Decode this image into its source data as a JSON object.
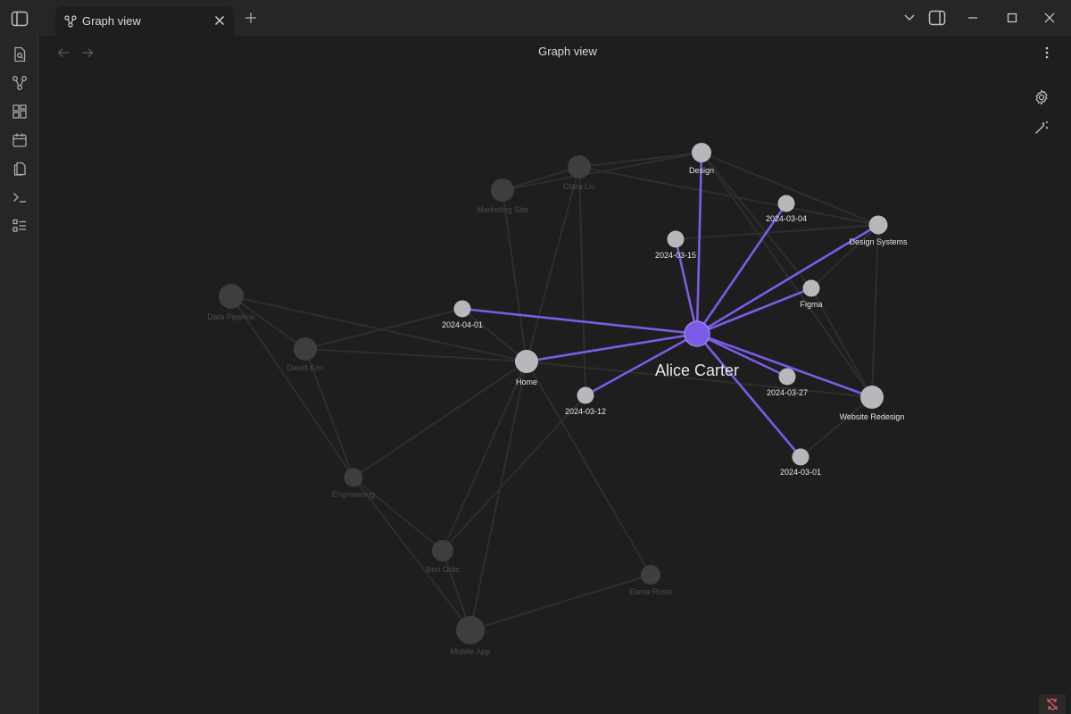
{
  "tab": {
    "label": "Graph view",
    "icon": "graph-icon"
  },
  "header": {
    "title": "Graph view"
  },
  "colors": {
    "background": "#1e1e1e",
    "accent": "#7c5ce6",
    "node_active": "#b8b8bc",
    "node_dim": "#3e3e3e",
    "edge_dim": "#2e2e2e"
  },
  "icons": {
    "ribbon": [
      "open-quick-switcher-icon",
      "graph-icon",
      "canvas-icon",
      "calendar-icon",
      "files-icon",
      "terminal-icon",
      "tasks-icon"
    ],
    "graph_controls": [
      "gear-icon",
      "magic-wand-icon"
    ]
  },
  "graph": {
    "focus": "Alice Carter",
    "nodes": [
      {
        "id": "alice",
        "label": "Alice Carter",
        "state": "focus"
      },
      {
        "id": "design",
        "label": "Design",
        "state": "linked"
      },
      {
        "id": "d0304",
        "label": "2024-03-04",
        "state": "linked"
      },
      {
        "id": "designsys",
        "label": "Design Systems",
        "state": "linked"
      },
      {
        "id": "d0315",
        "label": "2024-03-15",
        "state": "linked"
      },
      {
        "id": "figma",
        "label": "Figma",
        "state": "linked"
      },
      {
        "id": "d0401",
        "label": "2024-04-01",
        "state": "linked"
      },
      {
        "id": "home",
        "label": "Home",
        "state": "linked"
      },
      {
        "id": "d0312",
        "label": "2024-03-12",
        "state": "linked"
      },
      {
        "id": "d0327",
        "label": "2024-03-27",
        "state": "linked"
      },
      {
        "id": "website",
        "label": "Website Redesign",
        "state": "linked"
      },
      {
        "id": "d0301",
        "label": "2024-03-01",
        "state": "linked"
      },
      {
        "id": "clara",
        "label": "Clara Lin",
        "state": "dim"
      },
      {
        "id": "marketing",
        "label": "Marketing Site",
        "state": "dim"
      },
      {
        "id": "datapipe",
        "label": "Data Pipeline",
        "state": "dim"
      },
      {
        "id": "david",
        "label": "David Kim",
        "state": "dim"
      },
      {
        "id": "engineering",
        "label": "Engineering",
        "state": "dim"
      },
      {
        "id": "ben",
        "label": "Ben Ortiz",
        "state": "dim"
      },
      {
        "id": "elena",
        "label": "Elena Rossi",
        "state": "dim"
      },
      {
        "id": "mobile",
        "label": "Mobile App",
        "state": "dim"
      }
    ],
    "links": [
      [
        "alice",
        "design"
      ],
      [
        "alice",
        "d0304"
      ],
      [
        "alice",
        "designsys"
      ],
      [
        "alice",
        "d0315"
      ],
      [
        "alice",
        "figma"
      ],
      [
        "alice",
        "d0401"
      ],
      [
        "alice",
        "home"
      ],
      [
        "alice",
        "d0312"
      ],
      [
        "alice",
        "d0327"
      ],
      [
        "alice",
        "website"
      ],
      [
        "alice",
        "d0301"
      ],
      [
        "design",
        "clara"
      ],
      [
        "design",
        "marketing"
      ],
      [
        "design",
        "designsys"
      ],
      [
        "design",
        "website"
      ],
      [
        "design",
        "figma"
      ],
      [
        "clara",
        "marketing"
      ],
      [
        "clara",
        "designsys"
      ],
      [
        "clara",
        "home"
      ],
      [
        "clara",
        "d0312"
      ],
      [
        "marketing",
        "home"
      ],
      [
        "designsys",
        "figma"
      ],
      [
        "designsys",
        "website"
      ],
      [
        "designsys",
        "d0315"
      ],
      [
        "figma",
        "website"
      ],
      [
        "website",
        "d0301"
      ],
      [
        "website",
        "home"
      ],
      [
        "home",
        "d0401"
      ],
      [
        "home",
        "david"
      ],
      [
        "home",
        "engineering"
      ],
      [
        "home",
        "ben"
      ],
      [
        "home",
        "mobile"
      ],
      [
        "home",
        "elena"
      ],
      [
        "datapipe",
        "david"
      ],
      [
        "datapipe",
        "home"
      ],
      [
        "datapipe",
        "engineering"
      ],
      [
        "david",
        "engineering"
      ],
      [
        "david",
        "d0401"
      ],
      [
        "engineering",
        "ben"
      ],
      [
        "engineering",
        "mobile"
      ],
      [
        "ben",
        "mobile"
      ],
      [
        "ben",
        "d0312"
      ],
      [
        "mobile",
        "elena"
      ]
    ]
  }
}
